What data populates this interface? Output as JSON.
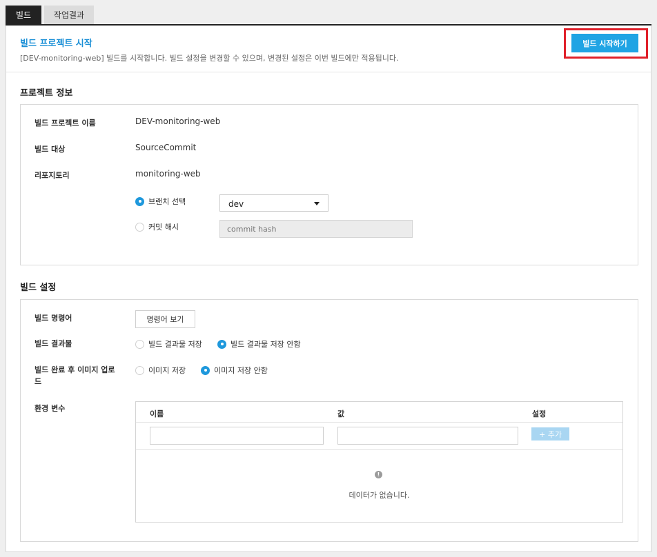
{
  "tabs": [
    {
      "label": "빌드",
      "active": true
    },
    {
      "label": "작업결과",
      "active": false
    }
  ],
  "header": {
    "title": "빌드 프로젝트 시작",
    "description": "[DEV-monitoring-web] 빌드를 시작합니다. 빌드 설정을 변경할 수 있으며, 변경된 설정은 이번 빌드에만 적용됩니다.",
    "start_button": "빌드 시작하기",
    "highlight_color": "#e0202a",
    "accent_color": "#20a4e4"
  },
  "project_info": {
    "section_title": "프로젝트 정보",
    "name_label": "빌드 프로젝트 이름",
    "name_value": "DEV-monitoring-web",
    "target_label": "빌드 대상",
    "target_value": "SourceCommit",
    "repo_label": "리포지토리",
    "repo_value": "monitoring-web",
    "branch_option": {
      "label": "브랜치 선택",
      "checked": true
    },
    "commit_option": {
      "label": "커밋 해시",
      "checked": false
    },
    "branch_selected": "dev",
    "commit_placeholder": "commit hash"
  },
  "build_settings": {
    "section_title": "빌드 설정",
    "command_label": "빌드 명령어",
    "command_button": "명령어 보기",
    "artifact_label": "빌드 결과물",
    "artifact_options": [
      {
        "label": "빌드 결과물 저장",
        "checked": false
      },
      {
        "label": "빌드 결과물 저장 안함",
        "checked": true
      }
    ],
    "image_label": "빌드 완료 후 이미지 업로드",
    "image_options": [
      {
        "label": "이미지 저장",
        "checked": false
      },
      {
        "label": "이미지 저장 안함",
        "checked": true
      }
    ],
    "env_label": "환경 변수",
    "env_table": {
      "col_name": "이름",
      "col_value": "값",
      "col_setting": "설정",
      "add_button": "+ 추가",
      "empty_icon": "info-icon",
      "empty_text": "데이터가 없습니다."
    }
  }
}
